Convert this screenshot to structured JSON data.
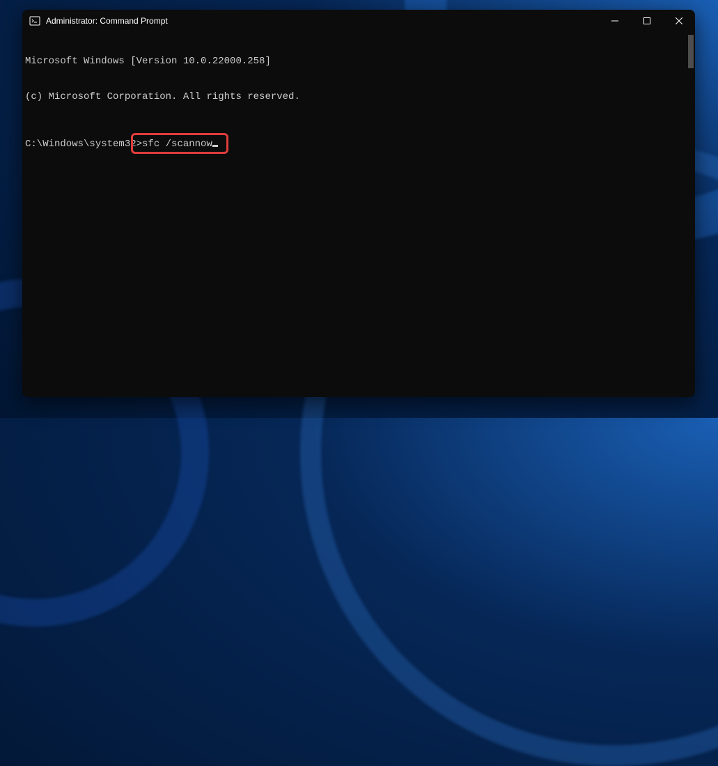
{
  "window": {
    "title": "Administrator: Command Prompt"
  },
  "terminal": {
    "line1": "Microsoft Windows [Version 10.0.22000.258]",
    "line2": "(c) Microsoft Corporation. All rights reserved.",
    "prompt": "C:\\Windows\\system32>",
    "command": "sfc /scannow"
  },
  "annotation": {
    "highlight_target": "command"
  }
}
